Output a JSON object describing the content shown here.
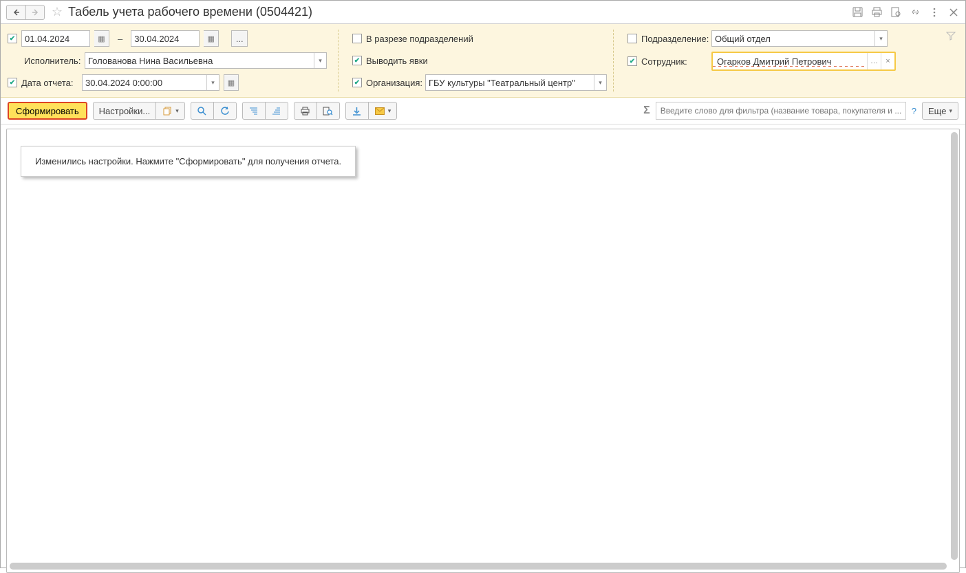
{
  "title": "Табель учета рабочего времени (0504421)",
  "filters": {
    "period_checked": true,
    "date_from": "01.04.2024",
    "date_to": "30.04.2024",
    "performer_label": "Исполнитель:",
    "performer_value": "Голованова Нина Васильевна",
    "report_date_checked": true,
    "report_date_label": "Дата отчета:",
    "report_date_value": "30.04.2024  0:00:00",
    "split_dept_checked": false,
    "split_dept_label": "В разрезе подразделений",
    "show_attendance_checked": true,
    "show_attendance_label": "Выводить явки",
    "org_checked": true,
    "org_label": "Организация:",
    "org_value": "ГБУ культуры \"Театральный центр\"",
    "dept_checked": false,
    "dept_label": "Подразделение:",
    "dept_value": "Общий отдел",
    "emp_checked": true,
    "emp_label": "Сотрудник:",
    "emp_value": "Огарков Дмитрий Петрович"
  },
  "toolbar": {
    "generate": "Сформировать",
    "settings": "Настройки...",
    "more": "Еще",
    "filter_placeholder": "Введите слово для фильтра (название товара, покупателя и ..."
  },
  "message": "Изменились настройки. Нажмите \"Сформировать\" для получения отчета."
}
